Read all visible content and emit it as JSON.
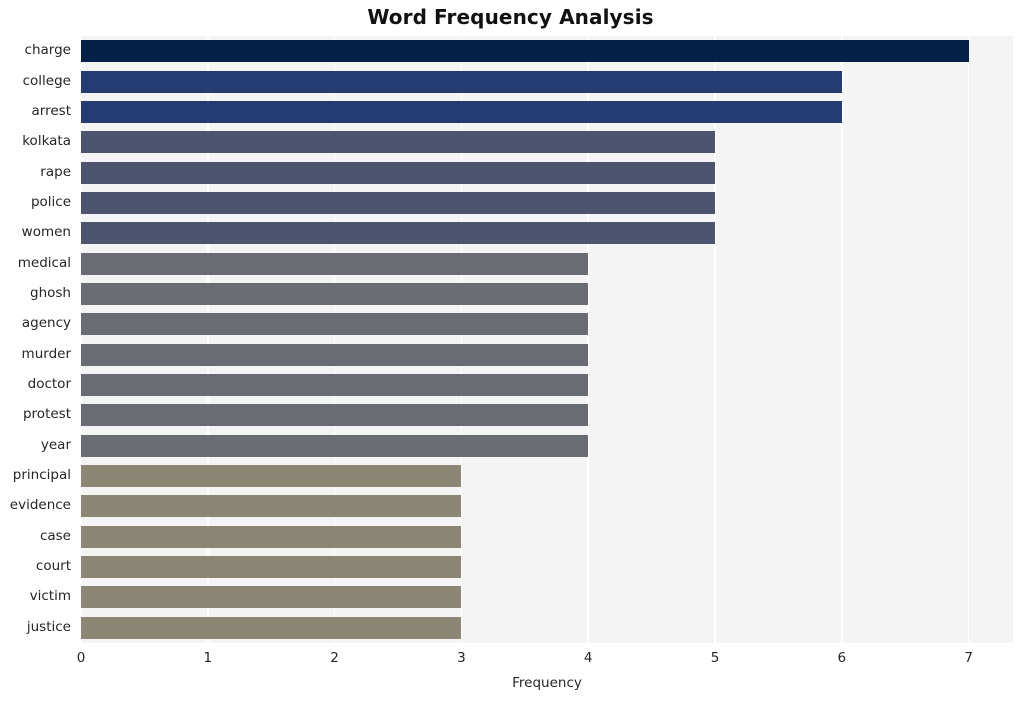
{
  "chart_data": {
    "type": "bar",
    "orientation": "horizontal",
    "title": "Word Frequency Analysis",
    "xlabel": "Frequency",
    "ylabel": "",
    "categories": [
      "charge",
      "college",
      "arrest",
      "kolkata",
      "rape",
      "police",
      "women",
      "medical",
      "ghosh",
      "agency",
      "murder",
      "doctor",
      "protest",
      "year",
      "principal",
      "evidence",
      "case",
      "court",
      "victim",
      "justice"
    ],
    "values": [
      7,
      6,
      6,
      5,
      5,
      5,
      5,
      4,
      4,
      4,
      4,
      4,
      4,
      4,
      3,
      3,
      3,
      3,
      3,
      3
    ],
    "bar_colors": [
      "#052049",
      "#243c72",
      "#243c72",
      "#4d5470",
      "#4d5470",
      "#4d5470",
      "#4d5470",
      "#696c72",
      "#696c72",
      "#696c72",
      "#696c72",
      "#696c72",
      "#696c72",
      "#696c72",
      "#8c8674",
      "#8c8674",
      "#8c8674",
      "#8c8674",
      "#8c8674",
      "#8c8674"
    ],
    "xlim": [
      0,
      7.35
    ],
    "xticks": [
      0,
      1,
      2,
      3,
      4,
      5,
      6,
      7
    ],
    "xtick_labels": [
      "0",
      "1",
      "2",
      "3",
      "4",
      "5",
      "6",
      "7"
    ],
    "grid": true,
    "grid_axis": "x",
    "legend": false,
    "plot_background": "#f4f4f5",
    "grid_color": "#ffffff",
    "figure_background": "#ffffff"
  }
}
